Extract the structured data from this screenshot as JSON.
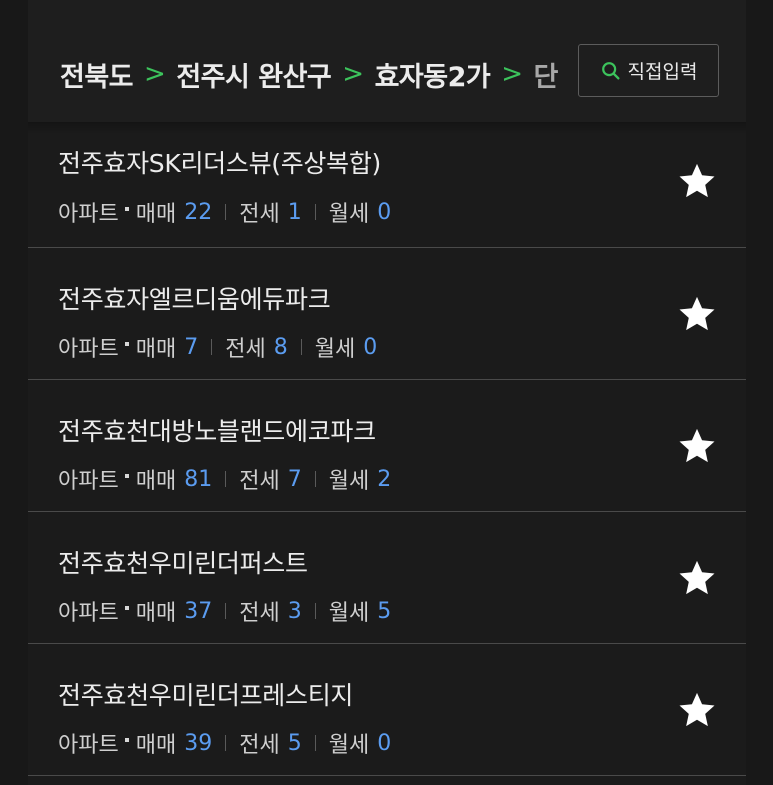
{
  "breadcrumb": {
    "province": "전북도",
    "city": "전주시 완산구",
    "dong": "효자동2가",
    "next_partial": "단"
  },
  "direct_input": {
    "label": "직접입력"
  },
  "stats_labels": {
    "type": "아파트",
    "sale": "매매",
    "jeonse": "전세",
    "monthly": "월세"
  },
  "colors": {
    "background": "#1b1b1b",
    "accent_green": "#3cc35c",
    "count_blue": "#5b9cf0"
  },
  "items": [
    {
      "name": "전주효자SK리더스뷰(주상복합)",
      "type": "아파트",
      "sale": "22",
      "jeonse": "1",
      "monthly": "0",
      "icon": "star-icon"
    },
    {
      "name": "전주효자엘르디움에듀파크",
      "type": "아파트",
      "sale": "7",
      "jeonse": "8",
      "monthly": "0",
      "icon": "star-icon"
    },
    {
      "name": "전주효천대방노블랜드에코파크",
      "type": "아파트",
      "sale": "81",
      "jeonse": "7",
      "monthly": "2",
      "icon": "star-icon"
    },
    {
      "name": "전주효천우미린더퍼스트",
      "type": "아파트",
      "sale": "37",
      "jeonse": "3",
      "monthly": "5",
      "icon": "star-icon"
    },
    {
      "name": "전주효천우미린더프레스티지",
      "type": "아파트",
      "sale": "39",
      "jeonse": "5",
      "monthly": "0",
      "icon": "star-icon"
    }
  ]
}
